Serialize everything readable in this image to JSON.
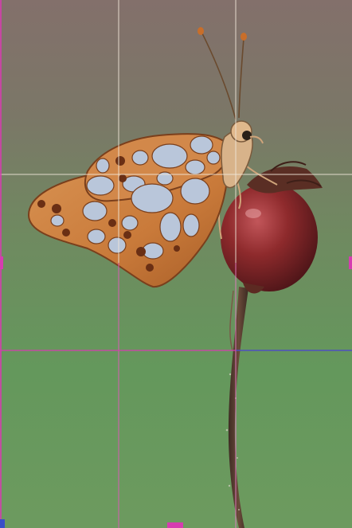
{
  "photo": {
    "subject": "butterfly-on-rosehip",
    "colors": {
      "background_top": "#82706a",
      "background_mid": "#6f8a60",
      "background_bottom": "#5f9a5a",
      "wing_orange": "#c97a3a",
      "wing_spot": "#b9c6da",
      "wing_vein": "#7a3f1c",
      "berry_red": "#8e2a2c",
      "stem_dark": "#5a3a2e"
    }
  },
  "grid_overlay": {
    "visible": true,
    "colors": {
      "light": "#f0e6d8",
      "magenta": "#d63cb0",
      "blue": "#3a4fc8"
    }
  }
}
